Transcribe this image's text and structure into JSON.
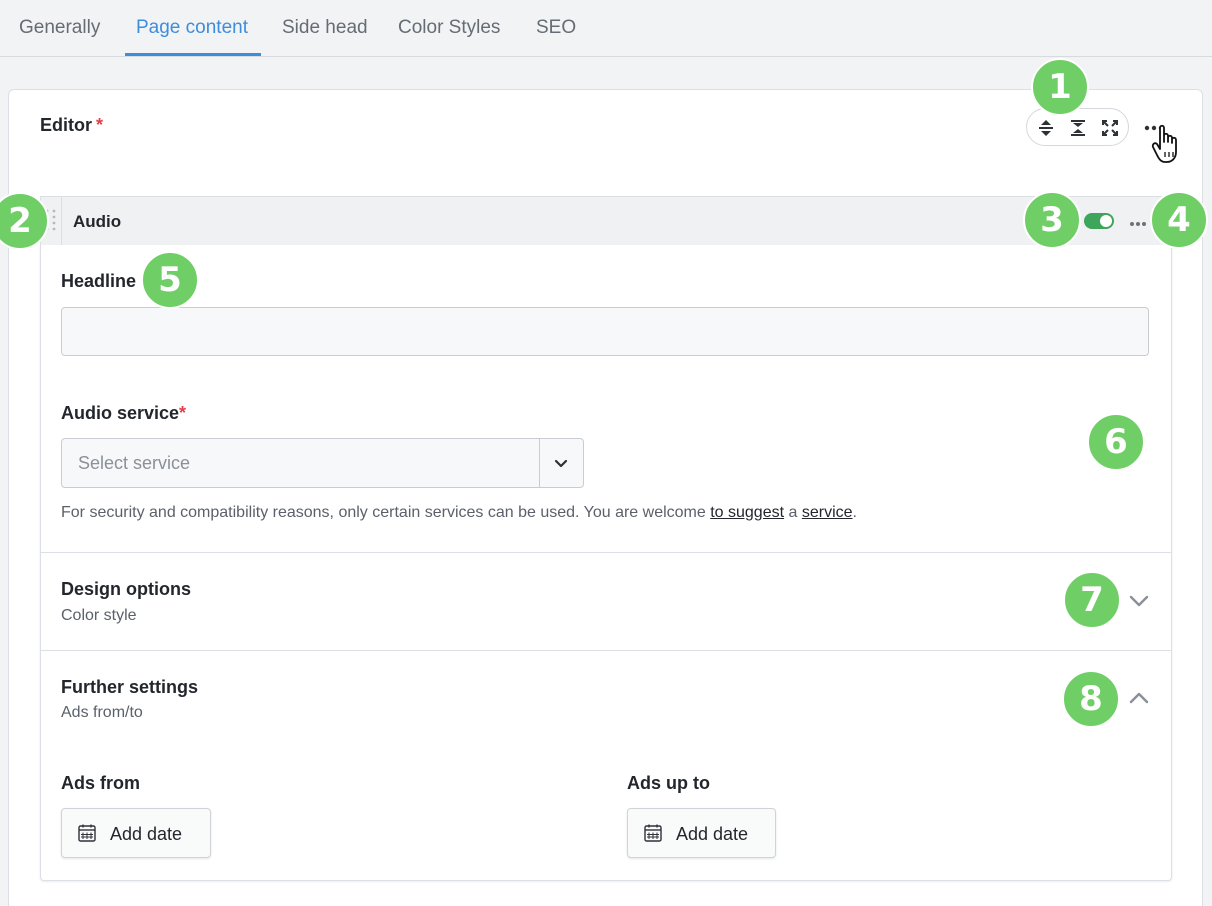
{
  "tabs": [
    {
      "label": "Generally"
    },
    {
      "label": "Page content"
    },
    {
      "label": "Side head"
    },
    {
      "label": "Color Styles"
    },
    {
      "label": "SEO"
    }
  ],
  "active_tab": "Page content",
  "editor": {
    "title": "Editor",
    "required_mark": "*",
    "toolbar_icons": [
      "collapse-all-icon",
      "expand-all-icon",
      "fullscreen-icon"
    ],
    "more_icon": "more-horizontal-icon"
  },
  "block": {
    "title": "Audio",
    "enabled": true,
    "headline_label": "Headline",
    "headline_value": "",
    "service_label": "Audio service",
    "required_mark": "*",
    "service_placeholder": "Select service",
    "hint_prefix": "For security and compatibility reasons, only certain services can be used. You are welcome ",
    "hint_link1": "to suggest",
    "hint_middle": " a ",
    "hint_link2": "service",
    "hint_suffix": ".",
    "design_title": "Design options",
    "design_sub": "Color style",
    "further_title": "Further settings",
    "further_sub": "Ads from/to",
    "ads_from_label": "Ads from",
    "ads_to_label": "Ads up to",
    "add_date_label": "Add date"
  },
  "badges": [
    "1",
    "2",
    "3",
    "4",
    "5",
    "6",
    "7",
    "8"
  ],
  "colors": {
    "accent": "#3d8ddb",
    "toggle_on": "#3fa55b",
    "badge": "#6fcf66",
    "required": "#e0414b"
  }
}
